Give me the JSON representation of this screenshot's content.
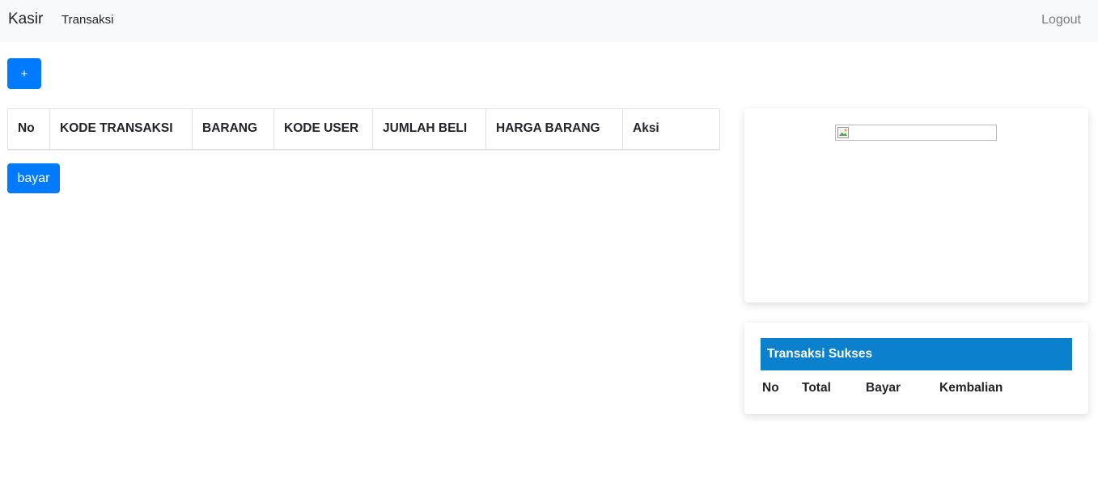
{
  "navbar": {
    "brand": "Kasir",
    "nav_item": "Transaksi",
    "logout": "Logout"
  },
  "actions": {
    "add_label": "+",
    "pay_label": "bayar"
  },
  "transaction_table": {
    "headers": [
      "No",
      "KODE TRANSAKSI",
      "BARANG",
      "KODE USER",
      "JUMLAH BELI",
      "HARGA BARANG",
      "Aksi"
    ],
    "rows": []
  },
  "image_card": {
    "image_icon": "broken-image-icon"
  },
  "success_card": {
    "title": "Transaksi Sukses",
    "headers": [
      "No",
      "Total",
      "Bayar",
      "Kembalian"
    ],
    "header_color": "#0b80cc"
  },
  "colors": {
    "primary": "#007bff",
    "navbar_bg": "#f8f9fa"
  }
}
